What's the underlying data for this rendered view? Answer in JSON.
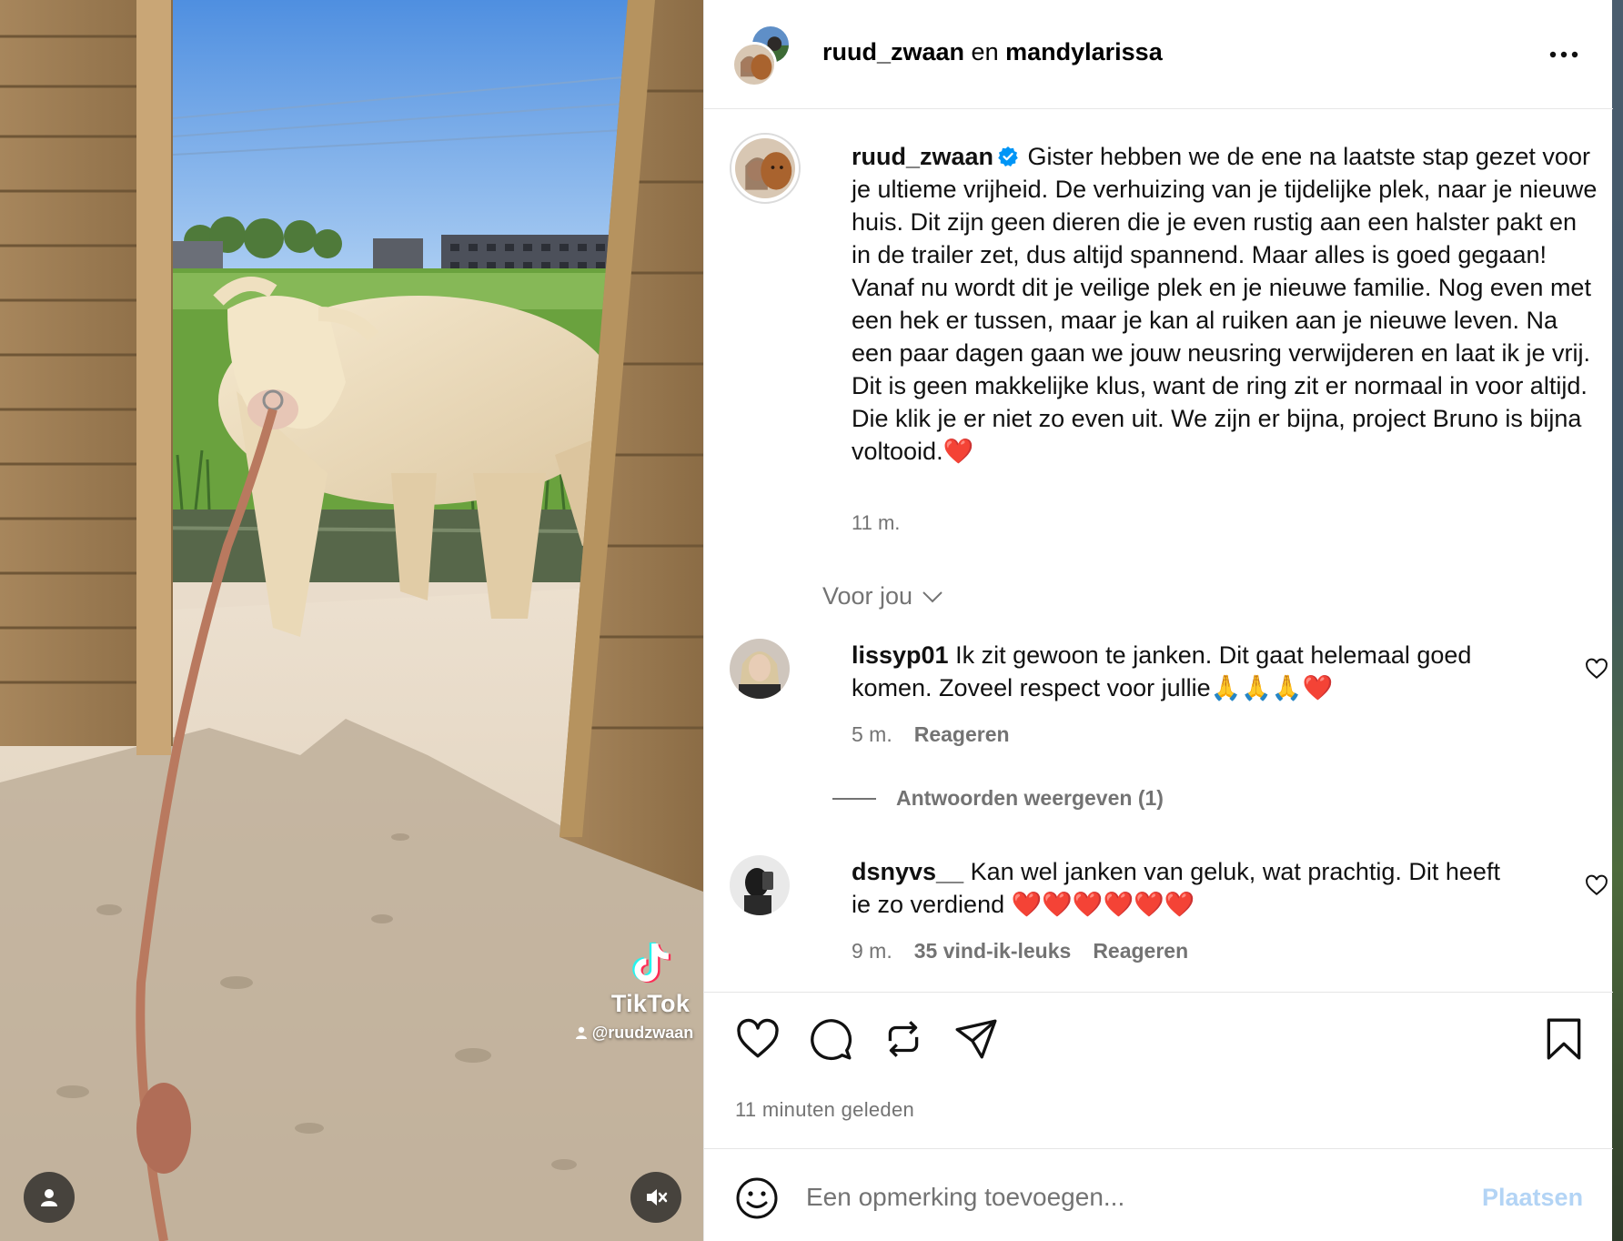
{
  "header": {
    "user1": "ruud_zwaan",
    "connector": "en",
    "user2": "mandylarissa"
  },
  "caption": {
    "username": "ruud_zwaan",
    "text": "Gister hebben we de ene na laatste stap gezet voor je ultieme vrijheid. De verhuizing van je tijdelijke plek, naar je nieuwe huis. Dit zijn geen dieren die je even rustig aan een halster pakt en in de trailer zet, dus altijd spannend. Maar alles is goed gegaan! Vanaf nu wordt dit je veilige plek en je nieuwe familie. Nog even met een hek er tussen, maar je kan al ruiken aan je nieuwe leven. Na een paar dagen gaan we jouw neusring verwijderen en laat ik je vrij. Dit is geen makkelijke klus, want de ring zit er normaal in voor altijd. Die klik je er niet zo even uit. We zijn er bijna, project Bruno is bijna voltooid.❤️",
    "time": "11 m."
  },
  "for_you": "Voor jou",
  "comments": [
    {
      "username": "lissyp01",
      "text": "Ik zit gewoon te janken. Dit gaat helemaal goed komen. Zoveel respect voor jullie🙏🙏🙏❤️",
      "time": "5 m.",
      "reply": "Reageren"
    },
    {
      "username": "dsnyvs__",
      "text": "Kan wel janken van geluk, wat prachtig. Dit heeft ie zo verdiend ❤️❤️❤️❤️❤️❤️",
      "time": "9 m.",
      "likes": "35 vind-ik-leuks",
      "reply": "Reageren"
    }
  ],
  "replies_toggle": "Antwoorden weergeven (1)",
  "timestamp": "11 minuten geleden",
  "composer": {
    "placeholder": "Een opmerking toevoegen...",
    "post": "Plaatsen"
  },
  "media": {
    "watermark_brand": "TikTok",
    "watermark_handle": "@ruudzwaan"
  },
  "icons": {
    "more": "more-horizontal-icon",
    "verified": "verified-badge-icon",
    "like": "heart-icon",
    "comment": "comment-bubble-icon",
    "repost": "repost-icon",
    "share": "paper-plane-icon",
    "save": "bookmark-icon",
    "emoji": "smiley-icon",
    "user": "user-icon",
    "mute": "speaker-muted-icon"
  },
  "colors": {
    "accent": "#0095f6",
    "post_disabled": "#b3d4f5",
    "secondary_text": "#737373",
    "heart_red": "#e0245e"
  }
}
